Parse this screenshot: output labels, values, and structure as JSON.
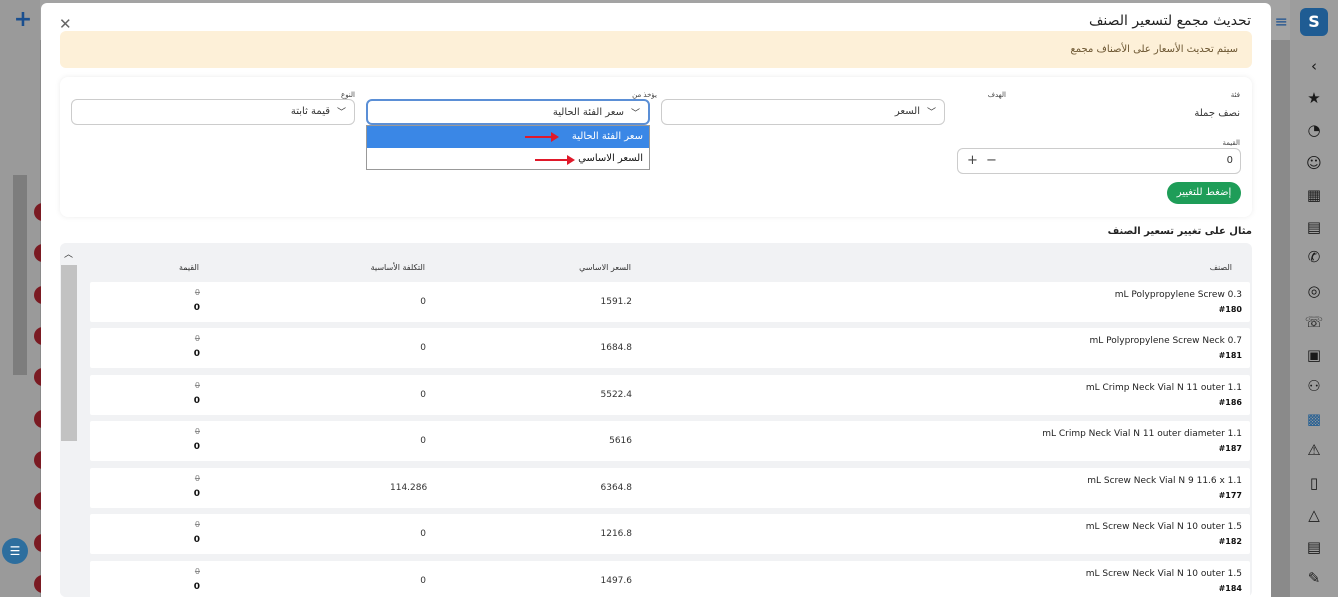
{
  "modal": {
    "title": "تحديث مجمع لتسعير الصنف",
    "close_glyph": "✕",
    "alert": "سيتم تحديث الأسعار على الأصناف مجمع"
  },
  "form": {
    "category": {
      "label": "فئة",
      "value": "نصف جملة"
    },
    "target": {
      "label": "الهدف",
      "value": "السعر"
    },
    "source": {
      "label": "يؤخذ من",
      "value": "سعر الفئة الحالية",
      "options": [
        "سعر الفئة الحالية",
        "السعر الاساسي"
      ]
    },
    "type": {
      "label": "النوع",
      "value": "قيمة ثابتة"
    },
    "amount": {
      "label": "القيمة",
      "value": "0"
    },
    "stepper": "+ −",
    "apply_label": "إضغط للتغيير"
  },
  "example": {
    "title": "مثال على تغيير تسعير الصنف",
    "columns": {
      "item": "الصنف",
      "basic_price": "السعر الاساسي",
      "basic_cost": "التكلفة الأساسية",
      "value": "القيمة"
    },
    "rows": [
      {
        "name": "mL Polypropylene Screw 0.3",
        "id": "#180",
        "basic_price": "1591.2",
        "basic_cost": "0",
        "old": "0",
        "new": "0"
      },
      {
        "name": "mL Polypropylene Screw Neck 0.7",
        "id": "#181",
        "basic_price": "1684.8",
        "basic_cost": "0",
        "old": "0",
        "new": "0"
      },
      {
        "name": "mL Crimp Neck Vial N 11 outer 1.1",
        "id": "#186",
        "basic_price": "5522.4",
        "basic_cost": "0",
        "old": "0",
        "new": "0"
      },
      {
        "name": "mL Crimp Neck Vial N 11 outer diameter 1.1",
        "id": "#187",
        "basic_price": "5616",
        "basic_cost": "0",
        "old": "0",
        "new": "0"
      },
      {
        "name": "mL Screw Neck Vial N 9 11.6 x 1.1",
        "id": "#177",
        "basic_price": "6364.8",
        "basic_cost": "114.286",
        "old": "0",
        "new": "0"
      },
      {
        "name": "mL Screw Neck Vial N 10 outer 1.5",
        "id": "#182",
        "basic_price": "1216.8",
        "basic_cost": "0",
        "old": "0",
        "new": "0"
      },
      {
        "name": "mL Screw Neck Vial N 10 outer 1.5",
        "id": "#184",
        "basic_price": "1497.6",
        "basic_cost": "0",
        "old": "0",
        "new": "0"
      }
    ]
  },
  "colors": {
    "primary": "#3a87e6",
    "success": "#1e9d58",
    "alert_bg": "#fdf0d8",
    "arrow": "#e0192a"
  }
}
